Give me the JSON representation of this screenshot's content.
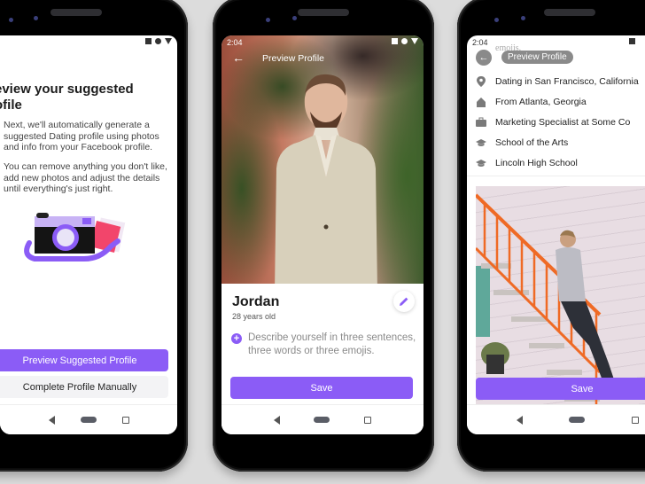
{
  "phone1": {
    "status_icons": [
      "square-icon",
      "circle-icon",
      "triangle-icon"
    ],
    "title": "Preview your suggested profile",
    "title_visible_line1": "eview your suggested",
    "title_visible_line2": "ofile",
    "paragraph1": "Next, we'll automatically generate a suggested Dating profile using photos and info from your Facebook profile.",
    "paragraph2": "You can remove anything you don't like, add new photos and adjust the details until everything's just right.",
    "illustration": "camera-illustration",
    "primary_button": "Preview Suggested Profile",
    "secondary_button": "Complete Profile Manually"
  },
  "phone2": {
    "time": "2:04",
    "header_title": "Preview Profile",
    "name": "Jordan",
    "age": "28 years old",
    "bio_placeholder": "Describe yourself in three sentences, three words or three emojis.",
    "save_button": "Save"
  },
  "phone3": {
    "time": "2:04",
    "header_title": "Preview Profile",
    "scrolled_text": "emojis.",
    "details": [
      {
        "icon": "location-pin-icon",
        "text": "Dating in San Francisco, California"
      },
      {
        "icon": "home-icon",
        "text": "From Atlanta, Georgia"
      },
      {
        "icon": "briefcase-icon",
        "text": "Marketing Specialist at Some Co"
      },
      {
        "icon": "graduation-cap-icon",
        "text": "School of the Arts"
      },
      {
        "icon": "graduation-cap-icon",
        "text": "Lincoln High School"
      }
    ],
    "save_button": "Save"
  },
  "colors": {
    "accent": "#8b5cf6",
    "background": "#dcdcdc"
  }
}
